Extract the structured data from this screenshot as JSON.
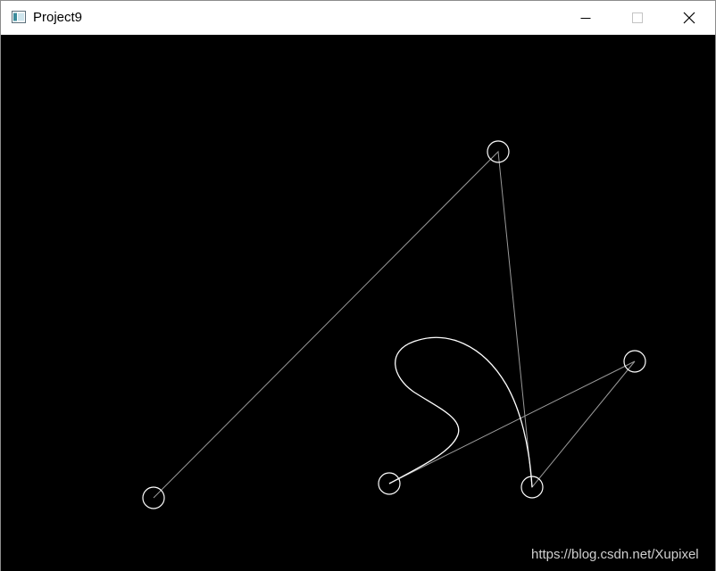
{
  "window": {
    "title": "Project9",
    "icons": {
      "app": "app-window-icon",
      "minimize": "minimize-icon",
      "maximize": "maximize-icon",
      "close": "close-icon"
    }
  },
  "canvas": {
    "background": "#000000",
    "control_point_color": "#ffffff",
    "polygon_color": "#9a9a9a",
    "curve_color": "#ffffff",
    "watermark": "https://blog.csdn.net/Xupixel"
  }
}
